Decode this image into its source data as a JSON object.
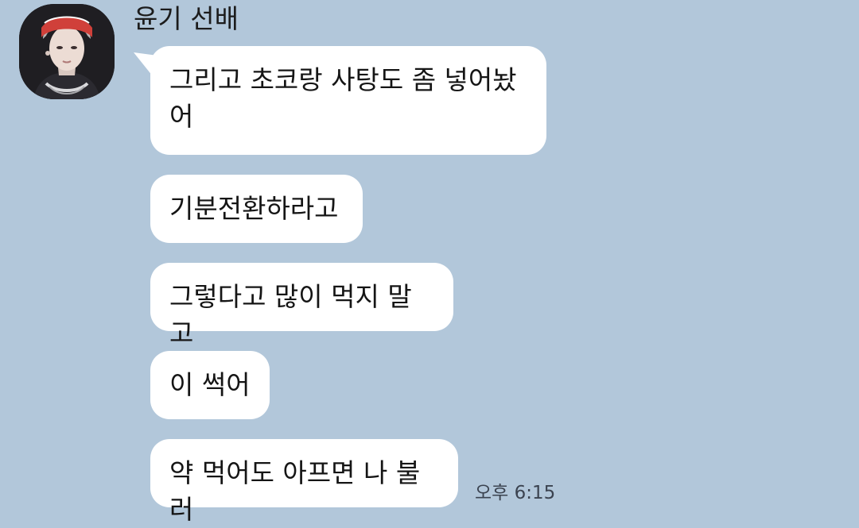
{
  "sender": {
    "name": "윤기 선배",
    "avatar_icon": "profile-photo"
  },
  "messages": [
    {
      "text": "그리고 초코랑 사탕도 좀 넣어놨\n어",
      "lines": [
        "그리고 초코랑 사탕도 좀 넣어놨",
        "어"
      ]
    },
    {
      "text": "기분전환하라고",
      "lines": [
        "기분전환하라고"
      ]
    },
    {
      "text": "그렇다고 많이 먹지 말고",
      "lines": [
        "그렇다고 많이 먹지 말고"
      ]
    },
    {
      "text": "이 썩어",
      "lines": [
        "이 썩어"
      ]
    },
    {
      "text": "약 먹어도 아프면 나 불러",
      "lines": [
        "약 먹어도 아프면 나 불러"
      ]
    }
  ],
  "timestamp": "오후 6:15",
  "colors": {
    "background": "#b2c7da",
    "bubble": "#ffffff",
    "text": "#151515"
  }
}
